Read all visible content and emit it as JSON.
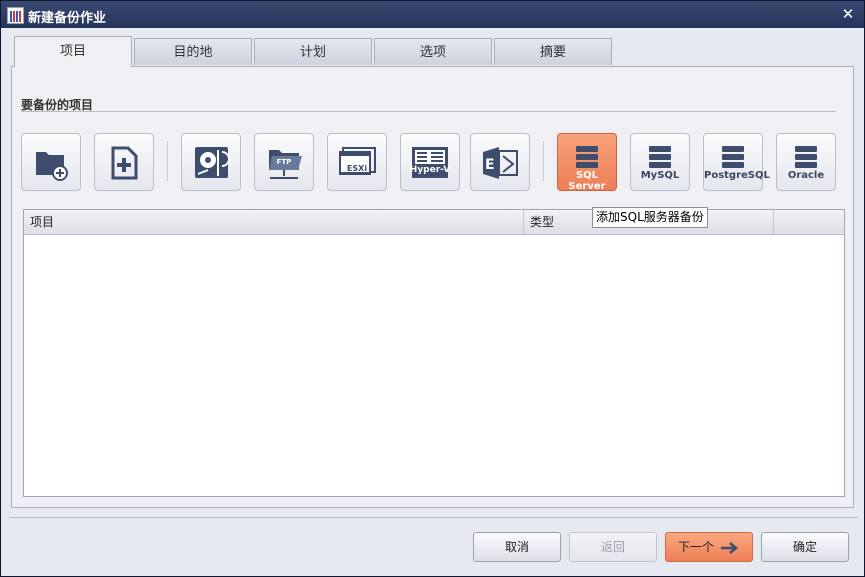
{
  "window": {
    "title": "新建备份作业",
    "close_glyph": "✕"
  },
  "tabs": [
    {
      "label": "项目",
      "active": true
    },
    {
      "label": "目的地",
      "active": false
    },
    {
      "label": "计划",
      "active": false
    },
    {
      "label": "选项",
      "active": false
    },
    {
      "label": "摘要",
      "active": false
    }
  ],
  "section": {
    "title": "要备份的项目"
  },
  "toolbar": {
    "items": [
      {
        "icon": "folder-add-icon",
        "label": ""
      },
      {
        "icon": "file-add-icon",
        "label": ""
      },
      {
        "icon": "disk-drive-icon",
        "label": ""
      },
      {
        "icon": "ftp-folder-icon",
        "label": ""
      },
      {
        "icon": "esxi-icon",
        "label": "ESXi"
      },
      {
        "icon": "hyper-v-icon",
        "label": "Hyper-V"
      },
      {
        "icon": "exchange-icon",
        "label": ""
      },
      {
        "icon": "database-icon",
        "label": "SQL Server",
        "selected": true
      },
      {
        "icon": "database-icon",
        "label": "MySQL"
      },
      {
        "icon": "database-icon",
        "label": "PostgreSQL"
      },
      {
        "icon": "database-icon",
        "label": "Oracle"
      }
    ],
    "ftp_badge": "FTP",
    "accent_color": "#ef8a5e"
  },
  "tooltip": {
    "text": "添加SQL服务器备份"
  },
  "table": {
    "columns": [
      "项目",
      "类型"
    ]
  },
  "buttons": {
    "cancel": "取消",
    "back": "返回",
    "next": "下一个",
    "ok": "确定"
  }
}
